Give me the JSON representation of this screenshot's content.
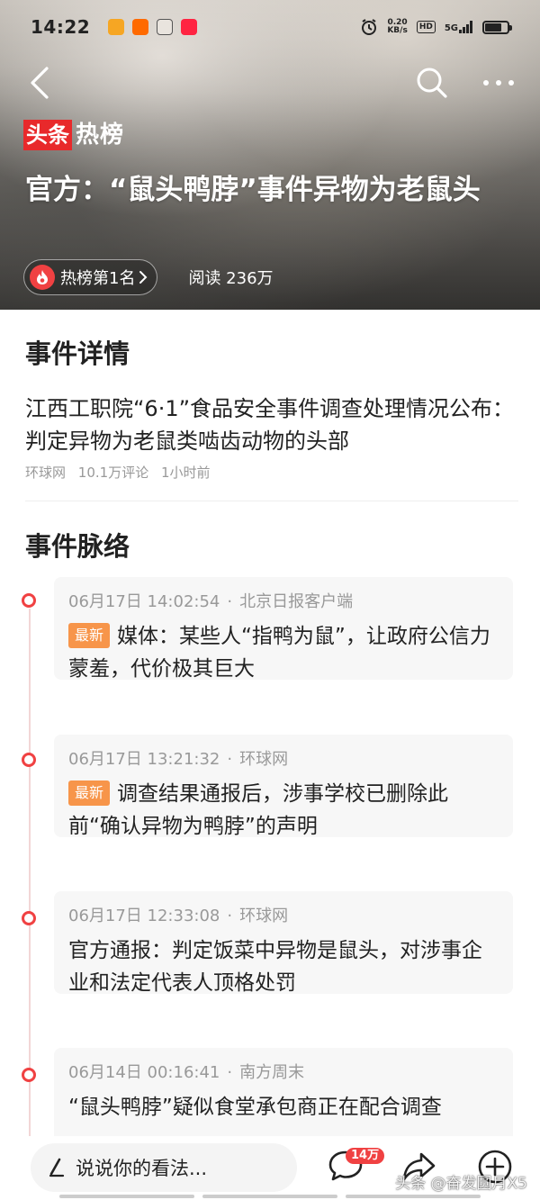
{
  "status_bar": {
    "time": "14:22",
    "speed_value": "0.20",
    "speed_unit": "KB/s",
    "hd_label": "HD",
    "network_label": "5G"
  },
  "brand": {
    "badge": "头条",
    "word": "热榜"
  },
  "hero": {
    "title": "官方：“鼠头鸭脖”事件异物为老鼠头",
    "rank_label": "热榜第1名",
    "read_count": "阅读 236万"
  },
  "detail": {
    "section_title": "事件详情",
    "headline": "江西工职院“6·1”食品安全事件调查处理情况公布：判定异物为老鼠类啮齿动物的头部",
    "source": "环球网",
    "comments": "10.1万评论",
    "time_ago": "1小时前"
  },
  "timeline": {
    "section_title": "事件脉络",
    "separator": "·",
    "new_tag": "最新",
    "items": [
      {
        "datetime": "06月17日 14:02:54",
        "source": "北京日报客户端",
        "is_new": true,
        "text": "媒体：某些人“指鸭为鼠”，让政府公信力蒙羞，代价极其巨大"
      },
      {
        "datetime": "06月17日 13:21:32",
        "source": "环球网",
        "is_new": true,
        "text": "调查结果通报后，涉事学校已删除此前“确认异物为鸭脖”的声明"
      },
      {
        "datetime": "06月17日 12:33:08",
        "source": "环球网",
        "is_new": false,
        "text": "官方通报：判定饭菜中异物是鼠头，对涉事企业和法定代表人顶格处罚"
      },
      {
        "datetime": "06月14日 00:16:41",
        "source": "南方周末",
        "is_new": false,
        "text": "“鼠头鸭脖”疑似食堂承包商正在配合调查"
      }
    ]
  },
  "bottom_bar": {
    "comment_placeholder": "说说你的看法...",
    "comment_count": "14万",
    "watermark": "头条 @奋发圆月X5"
  },
  "colors": {
    "accent_red": "#f04142",
    "brand_red": "#e8292b",
    "new_tag_orange": "#f7954a"
  },
  "icons": [
    "back-arrow-icon",
    "search-icon",
    "more-icon",
    "fire-icon",
    "chevron-right-icon",
    "pen-icon",
    "comment-icon",
    "share-icon",
    "add-icon"
  ]
}
